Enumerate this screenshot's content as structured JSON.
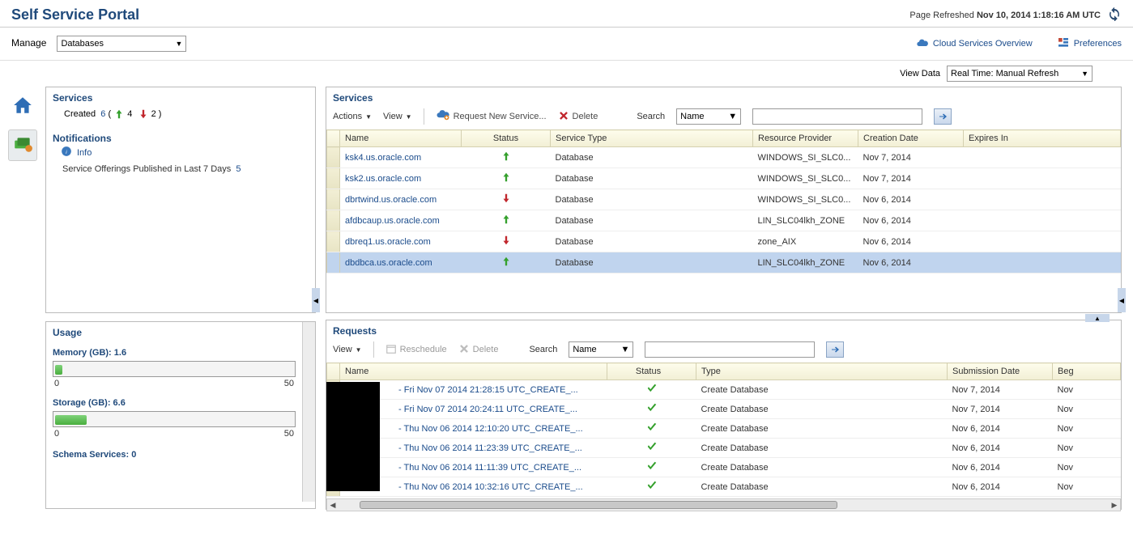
{
  "header": {
    "title": "Self Service Portal",
    "refresh_label": "Page Refreshed",
    "refresh_time": "Nov 10, 2014 1:18:16 AM UTC"
  },
  "toolbar": {
    "manage_label": "Manage",
    "manage_value": "Databases",
    "cloud_link": "Cloud Services Overview",
    "pref_link": "Preferences"
  },
  "viewdata": {
    "label": "View Data",
    "value": "Real Time: Manual Refresh"
  },
  "left": {
    "services_header": "Services",
    "created_label": "Created",
    "created_count": "6",
    "up_count": "4",
    "down_count": "2",
    "notifications_header": "Notifications",
    "info_label": "Info",
    "notif_text": "Service Offerings Published in Last 7 Days",
    "notif_count": "5",
    "usage_header": "Usage",
    "memory_label": "Memory (GB):  1.6",
    "storage_label": "Storage (GB):  6.6",
    "axis_min": "0",
    "axis_max": "50",
    "schema_label": "Schema Services:  0"
  },
  "services": {
    "header": "Services",
    "actions_label": "Actions",
    "view_label": "View",
    "request_label": "Request New Service...",
    "delete_label": "Delete",
    "search_label": "Search",
    "search_field": "Name",
    "cols": {
      "name": "Name",
      "status": "Status",
      "type": "Service Type",
      "provider": "Resource Provider",
      "cdate": "Creation Date",
      "expires": "Expires In"
    },
    "rows": [
      {
        "name": "ksk4.us.oracle.com",
        "status": "up",
        "type": "Database",
        "provider": "WINDOWS_SI_SLC0...",
        "cdate": "Nov 7, 2014",
        "expires": ""
      },
      {
        "name": "ksk2.us.oracle.com",
        "status": "up",
        "type": "Database",
        "provider": "WINDOWS_SI_SLC0...",
        "cdate": "Nov 7, 2014",
        "expires": ""
      },
      {
        "name": "dbrtwind.us.oracle.com",
        "status": "down",
        "type": "Database",
        "provider": "WINDOWS_SI_SLC0...",
        "cdate": "Nov 6, 2014",
        "expires": ""
      },
      {
        "name": "afdbcaup.us.oracle.com",
        "status": "up",
        "type": "Database",
        "provider": "LIN_SLC04lkh_ZONE",
        "cdate": "Nov 6, 2014",
        "expires": ""
      },
      {
        "name": "dbreq1.us.oracle.com",
        "status": "down",
        "type": "Database",
        "provider": "zone_AIX",
        "cdate": "Nov 6, 2014",
        "expires": ""
      },
      {
        "name": "dbdbca.us.oracle.com",
        "status": "up",
        "type": "Database",
        "provider": "LIN_SLC04lkh_ZONE",
        "cdate": "Nov 6, 2014",
        "expires": "",
        "selected": true
      }
    ]
  },
  "requests": {
    "header": "Requests",
    "view_label": "View",
    "reschedule_label": "Reschedule",
    "delete_label": "Delete",
    "search_label": "Search",
    "search_field": "Name",
    "cols": {
      "name": "Name",
      "status": "Status",
      "type": "Type",
      "subdate": "Submission Date",
      "begin": "Beg"
    },
    "rows": [
      {
        "name": "- Fri Nov 07 2014 21:28:15 UTC_CREATE_...",
        "type": "Create Database",
        "subdate": "Nov 7, 2014",
        "begin": "Nov"
      },
      {
        "name": "- Fri Nov 07 2014 20:24:11 UTC_CREATE_...",
        "type": "Create Database",
        "subdate": "Nov 7, 2014",
        "begin": "Nov"
      },
      {
        "name": "- Thu Nov 06 2014 12:10:20 UTC_CREATE_...",
        "type": "Create Database",
        "subdate": "Nov 6, 2014",
        "begin": "Nov"
      },
      {
        "name": "- Thu Nov 06 2014 11:23:39 UTC_CREATE_...",
        "type": "Create Database",
        "subdate": "Nov 6, 2014",
        "begin": "Nov"
      },
      {
        "name": "- Thu Nov 06 2014 11:11:39 UTC_CREATE_...",
        "type": "Create Database",
        "subdate": "Nov 6, 2014",
        "begin": "Nov"
      },
      {
        "name": "- Thu Nov 06 2014 10:32:16 UTC_CREATE_...",
        "type": "Create Database",
        "subdate": "Nov 6, 2014",
        "begin": "Nov"
      }
    ]
  }
}
